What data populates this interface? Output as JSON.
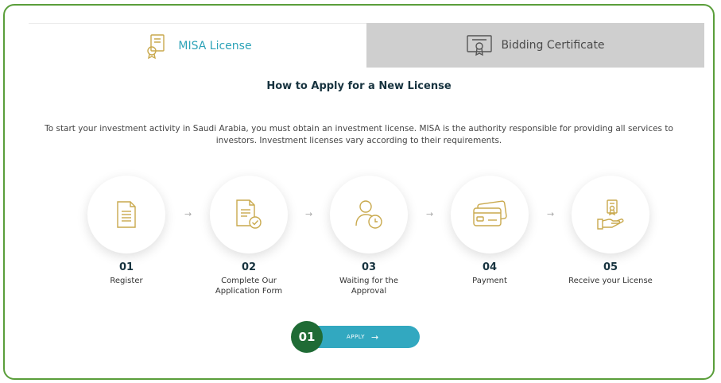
{
  "tabs": [
    {
      "label": "MISA License",
      "icon": "license-award-icon",
      "active": true
    },
    {
      "label": "Bidding Certificate",
      "icon": "certificate-icon",
      "active": false
    }
  ],
  "heading": "How to Apply for a New License",
  "intro": "To start your investment activity in Saudi Arabia, you must obtain an investment license. MISA is the authority responsible for providing all services to investors. Investment licenses vary according to their requirements.",
  "steps": [
    {
      "number": "01",
      "label": "Register",
      "icon": "document-icon"
    },
    {
      "number": "02",
      "label": "Complete Our Application Form",
      "icon": "form-check-icon"
    },
    {
      "number": "03",
      "label": "Waiting for the Approval",
      "icon": "user-clock-icon"
    },
    {
      "number": "04",
      "label": "Payment",
      "icon": "credit-card-icon"
    },
    {
      "number": "05",
      "label": "Receive your License",
      "icon": "hand-certificate-icon"
    }
  ],
  "arrow_glyph": "→",
  "apply": {
    "label": "APPLY",
    "arrow": "→",
    "badge": "01"
  },
  "colors": {
    "accent": "#32a8c0",
    "gold": "#c9a94d",
    "badge": "#1f6b35",
    "frame": "#5a9e3a",
    "inactive_tab": "#cfcfcf"
  }
}
